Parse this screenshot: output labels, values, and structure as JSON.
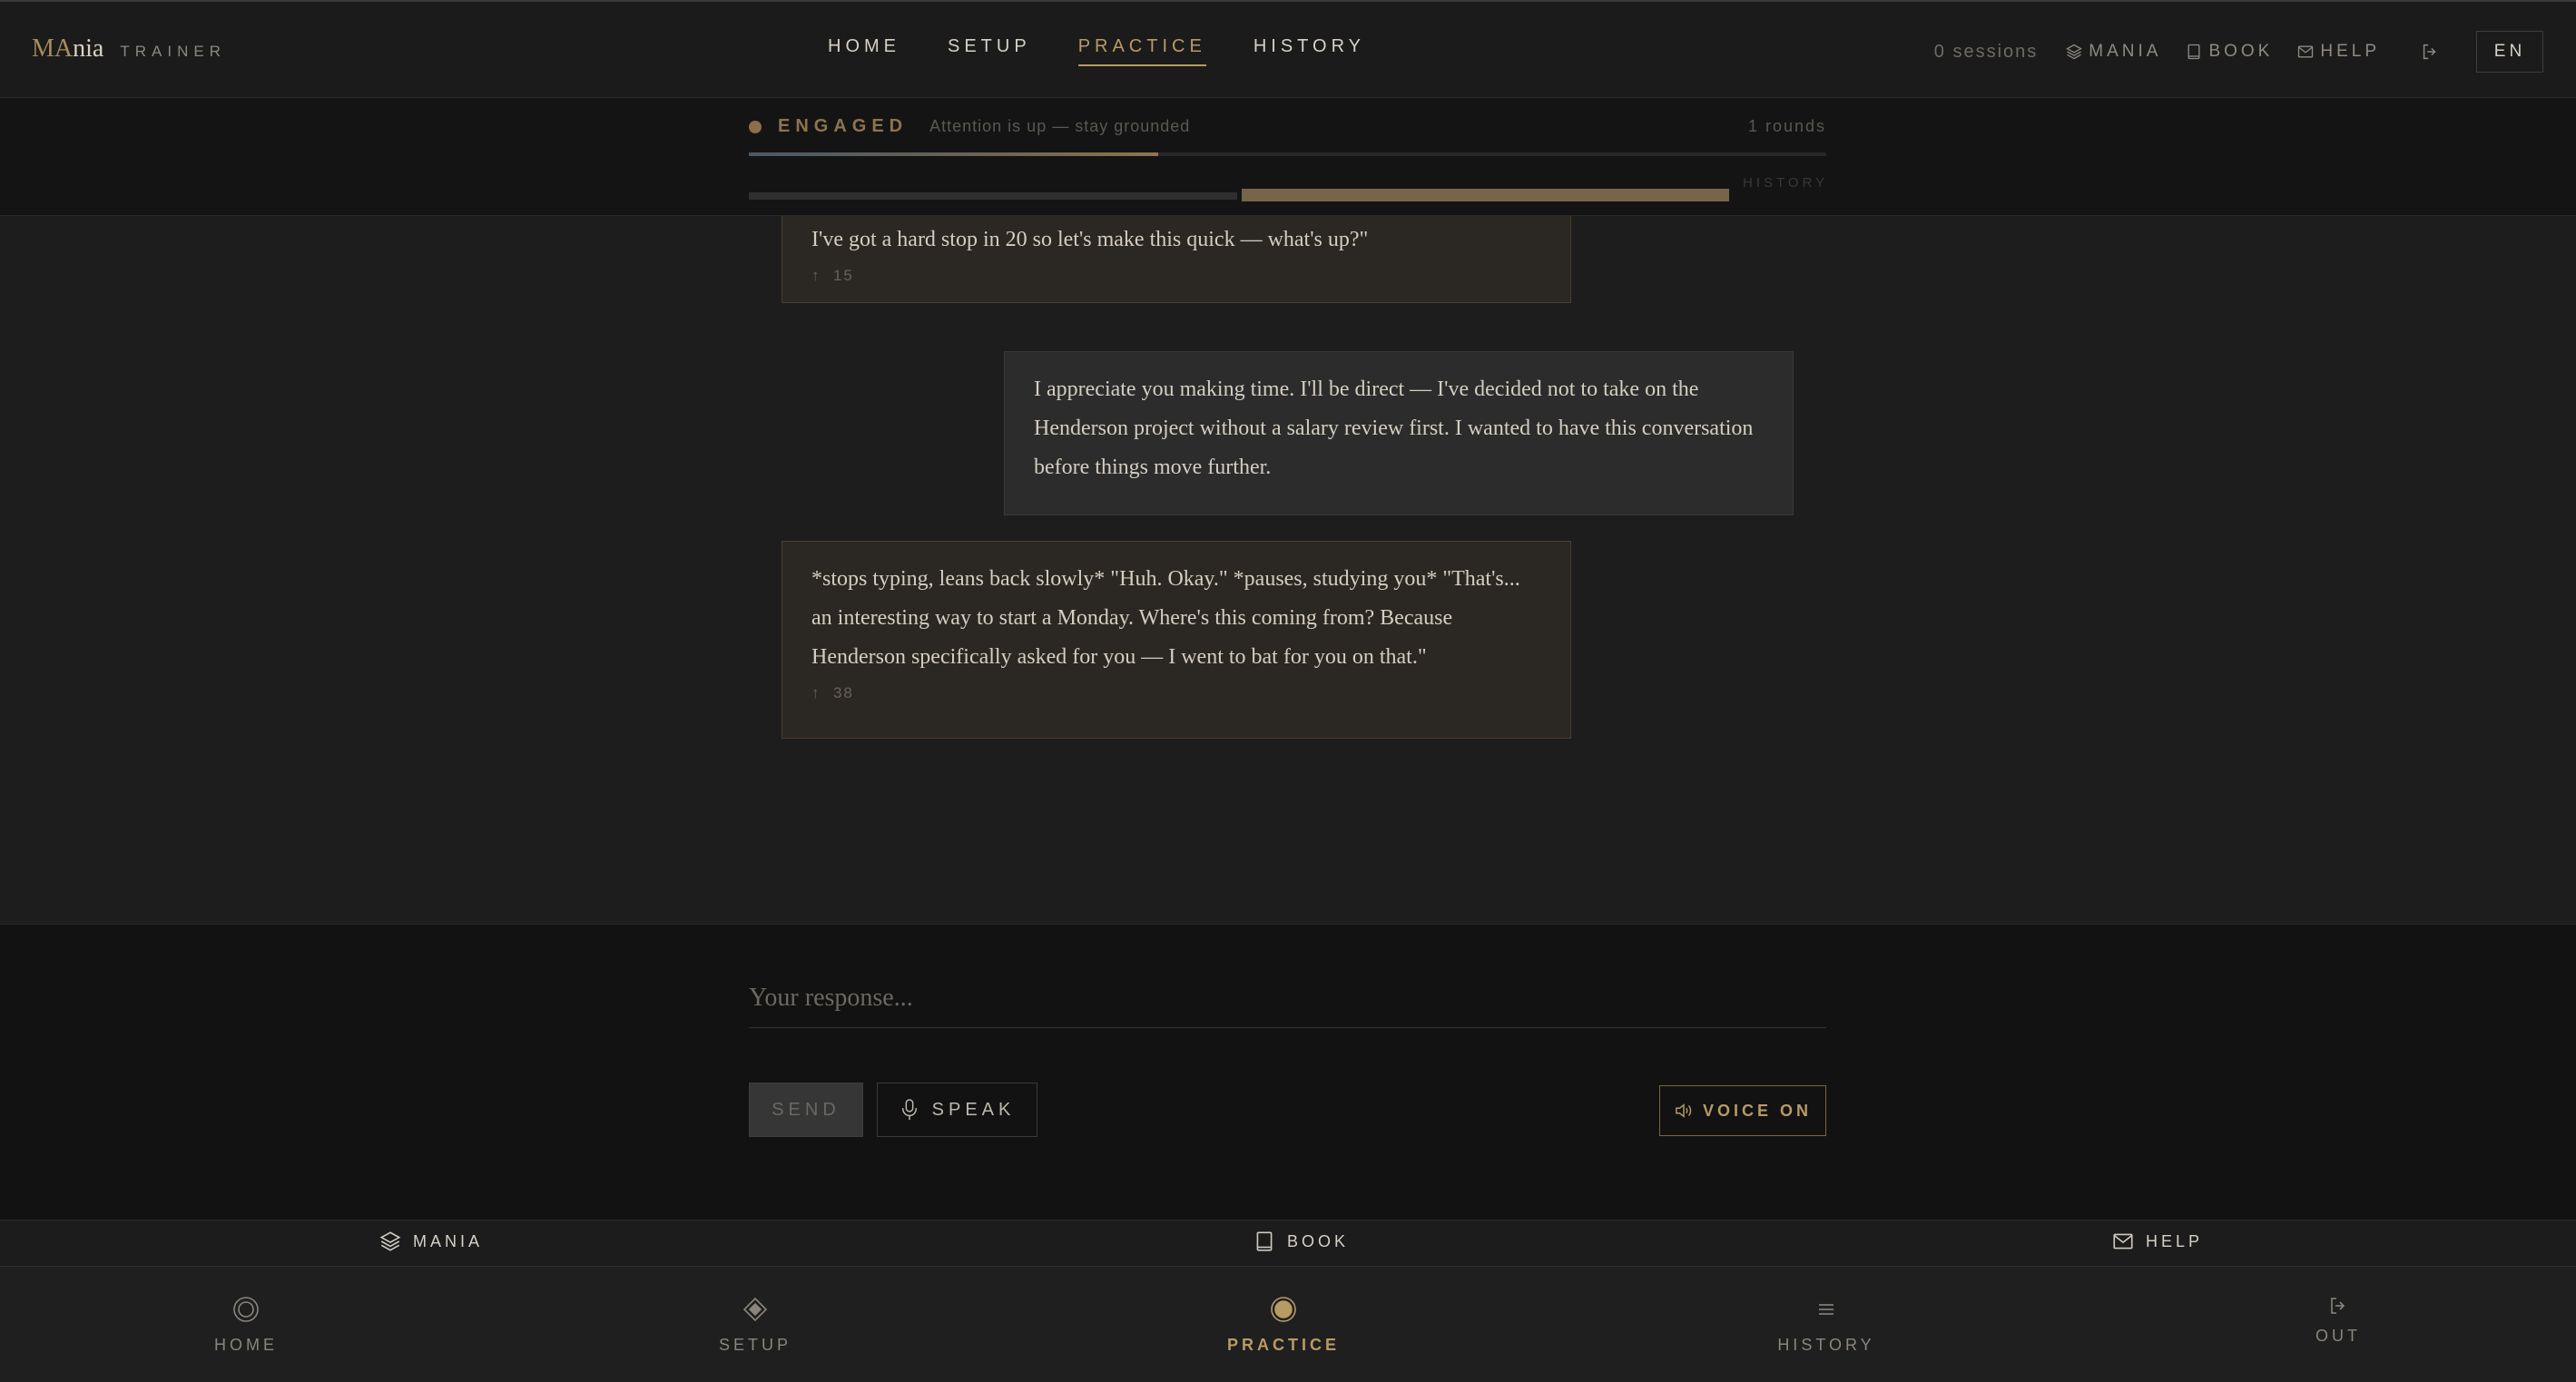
{
  "brand": {
    "main_hl": "MA",
    "main_rest": "nia",
    "sub": "TRAINER"
  },
  "topnav": {
    "items": [
      {
        "label": "HOME"
      },
      {
        "label": "SETUP"
      },
      {
        "label": "PRACTICE",
        "active": true
      },
      {
        "label": "HISTORY"
      }
    ]
  },
  "topright": {
    "sessions": "0 sessions",
    "mania": "MANIA",
    "book": "BOOK",
    "help": "HELP",
    "lang": "EN"
  },
  "status": {
    "label": "ENGAGED",
    "description": "Attention is up — stay grounded",
    "rounds": "1 rounds",
    "progress_fraction": 0.38,
    "history_label": "HISTORY"
  },
  "messages": [
    {
      "role": "bot",
      "text": "I've got a hard stop in 20 so let's make this quick — what's up?\"",
      "score": "15"
    },
    {
      "role": "user",
      "text": "I appreciate you making time. I'll be direct — I've decided not to take on the Henderson project without a salary review first. I wanted to have this conversation before things move further."
    },
    {
      "role": "bot",
      "text": "*stops typing, leans back slowly* \"Huh. Okay.\" *pauses, studying you* \"That's... an interesting way to start a Monday. Where's this coming from? Because Henderson specifically asked for you — I went to bat for you on that.\"",
      "score": "38"
    }
  ],
  "composer": {
    "placeholder": "Your response...",
    "send": "SEND",
    "speak": "SPEAK",
    "voice": "VOICE ON"
  },
  "subbar": {
    "mania": "MANIA",
    "book": "BOOK",
    "help": "HELP"
  },
  "bottomnav": {
    "home": "HOME",
    "setup": "SETUP",
    "practice": "PRACTICE",
    "history": "HISTORY",
    "out": "OUT"
  },
  "colors": {
    "accent": "#b89a66",
    "status": "#8d744f",
    "bot_bubble": "#2b2722",
    "user_bubble": "#2c2c2c"
  }
}
